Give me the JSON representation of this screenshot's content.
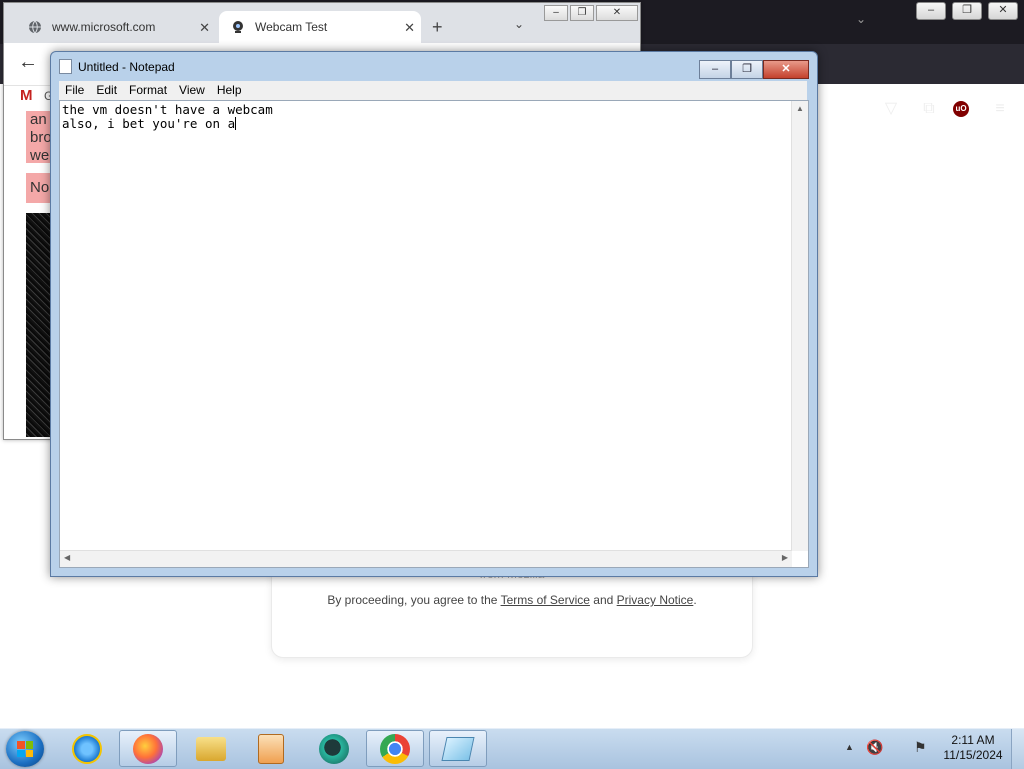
{
  "firefox": {
    "window_controls": [
      "–",
      "❐",
      "✕"
    ],
    "toolbar_icons": [
      "pocket-icon",
      "extensions-icon",
      "ublock-icon",
      "menu-icon"
    ],
    "ublock_label": "uO",
    "page": {
      "faded_text": "from Mozilla",
      "agree_prefix": "By proceeding, you agree to the",
      "terms_link": "Terms of Service",
      "and_text": "and",
      "privacy_link": "Privacy Notice",
      "period": "."
    }
  },
  "chrome": {
    "tabs": [
      {
        "title": "www.microsoft.com",
        "icon": "globe-icon"
      },
      {
        "title": "Webcam Test",
        "icon": "webcam-icon"
      }
    ],
    "new_tab": "+",
    "tab_dropdown": "⌄",
    "window_controls": [
      "–",
      "❐",
      "✕"
    ],
    "bookmark_gmail": "M",
    "bookmark_label": "G",
    "alert1_text": "an bro we",
    "alert2_text": "No"
  },
  "notepad": {
    "title": "Untitled - Notepad",
    "menu": [
      "File",
      "Edit",
      "Format",
      "View",
      "Help"
    ],
    "text_line1": "the vm doesn't have a webcam",
    "text_line2": "also, i bet you're on a",
    "window_controls": [
      "–",
      "❐",
      "✕"
    ]
  },
  "taskbar": {
    "apps": [
      "internet-explorer-icon",
      "firefox-icon",
      "file-explorer-icon",
      "media-player-icon",
      "app-icon",
      "chrome-icon",
      "notepad-icon"
    ],
    "time": "2:11 AM",
    "date": "11/15/2024"
  }
}
